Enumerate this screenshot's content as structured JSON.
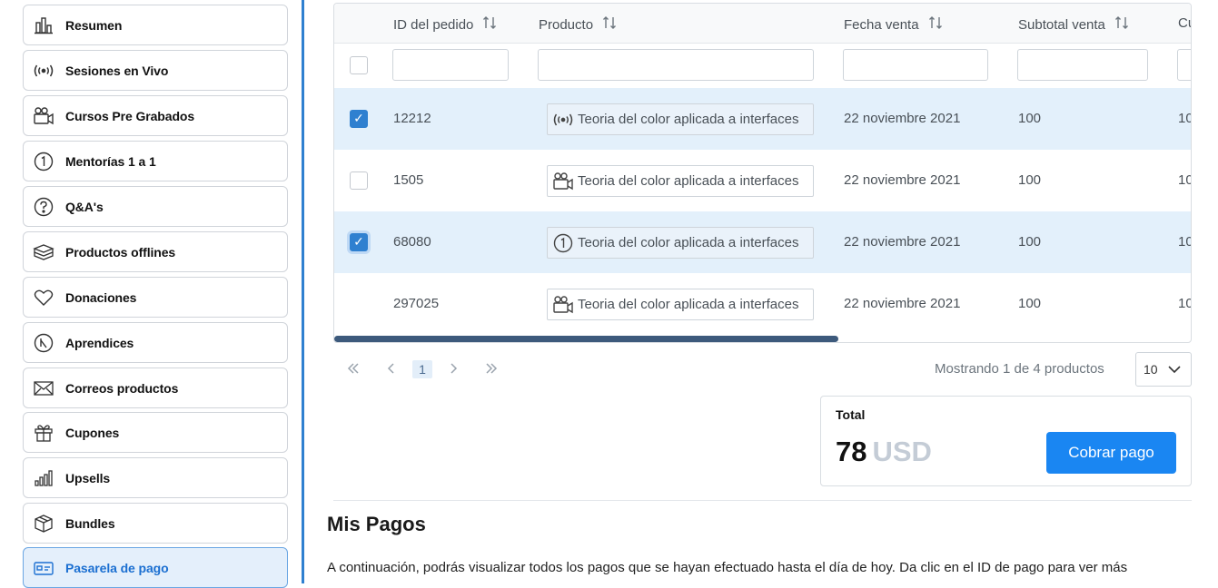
{
  "sidebar": {
    "items": [
      {
        "label": "Resumen",
        "icon": "chart-icon"
      },
      {
        "label": "Sesiones en Vivo",
        "icon": "broadcast-icon"
      },
      {
        "label": "Cursos Pre Grabados",
        "icon": "video-camera-icon"
      },
      {
        "label": "Mentorías 1 a 1",
        "icon": "number-one-icon"
      },
      {
        "label": "Q&A's",
        "icon": "question-icon"
      },
      {
        "label": "Productos offlines",
        "icon": "box-stack-icon"
      },
      {
        "label": "Donaciones",
        "icon": "heart-icon"
      },
      {
        "label": "Aprendices",
        "icon": "learner-icon"
      },
      {
        "label": "Correos productos",
        "icon": "envelope-icon"
      },
      {
        "label": "Cupones",
        "icon": "gift-icon"
      },
      {
        "label": "Upsells",
        "icon": "bar-chart-icon"
      },
      {
        "label": "Bundles",
        "icon": "cube-icon"
      },
      {
        "label": "Pasarela de pago",
        "icon": "wallet-icon",
        "active": true
      }
    ]
  },
  "table": {
    "headers": {
      "order_id": "ID del pedido",
      "product": "Producto",
      "date": "Fecha venta",
      "subtotal": "Subtotal venta",
      "next": "Cu"
    },
    "rows": [
      {
        "selected": true,
        "checkbox": "checked",
        "id": "12212",
        "product": "Teoria del color aplicada a interfaces",
        "product_icon": "broadcast-icon",
        "date": "22 noviembre 2021",
        "subtotal": "100",
        "next": "10"
      },
      {
        "selected": false,
        "checkbox": "unchecked",
        "id": "1505",
        "product": "Teoria del color aplicada a interfaces",
        "product_icon": "video-camera-icon",
        "date": "22 noviembre 2021",
        "subtotal": "100",
        "next": "10"
      },
      {
        "selected": true,
        "checkbox": "checked",
        "id": "68080",
        "product": "Teoria del color aplicada a interfaces",
        "product_icon": "number-one-icon",
        "date": "22 noviembre 2021",
        "subtotal": "100",
        "next": "10"
      },
      {
        "selected": false,
        "checkbox": "none",
        "id": "297025",
        "product": "Teoria del color aplicada a interfaces",
        "product_icon": "video-camera-icon",
        "date": "22 noviembre 2021",
        "subtotal": "100",
        "next": "10"
      }
    ]
  },
  "pagination": {
    "current_page": "1",
    "showing": "Mostrando 1 de 4 productos",
    "per_page": "10"
  },
  "total": {
    "label": "Total",
    "amount": "78",
    "currency": "USD",
    "pay_button": "Cobrar pago"
  },
  "payments": {
    "title": "Mis Pagos",
    "description": "A continuación, podrás visualizar todos los pagos que se hayan efectuado hasta el día de hoy. Da clic en el ID de pago para ver más"
  },
  "colors": {
    "accent": "#1a86f2",
    "sidebar_border": "#2f80d0",
    "selected_row": "#e3f0fb"
  }
}
